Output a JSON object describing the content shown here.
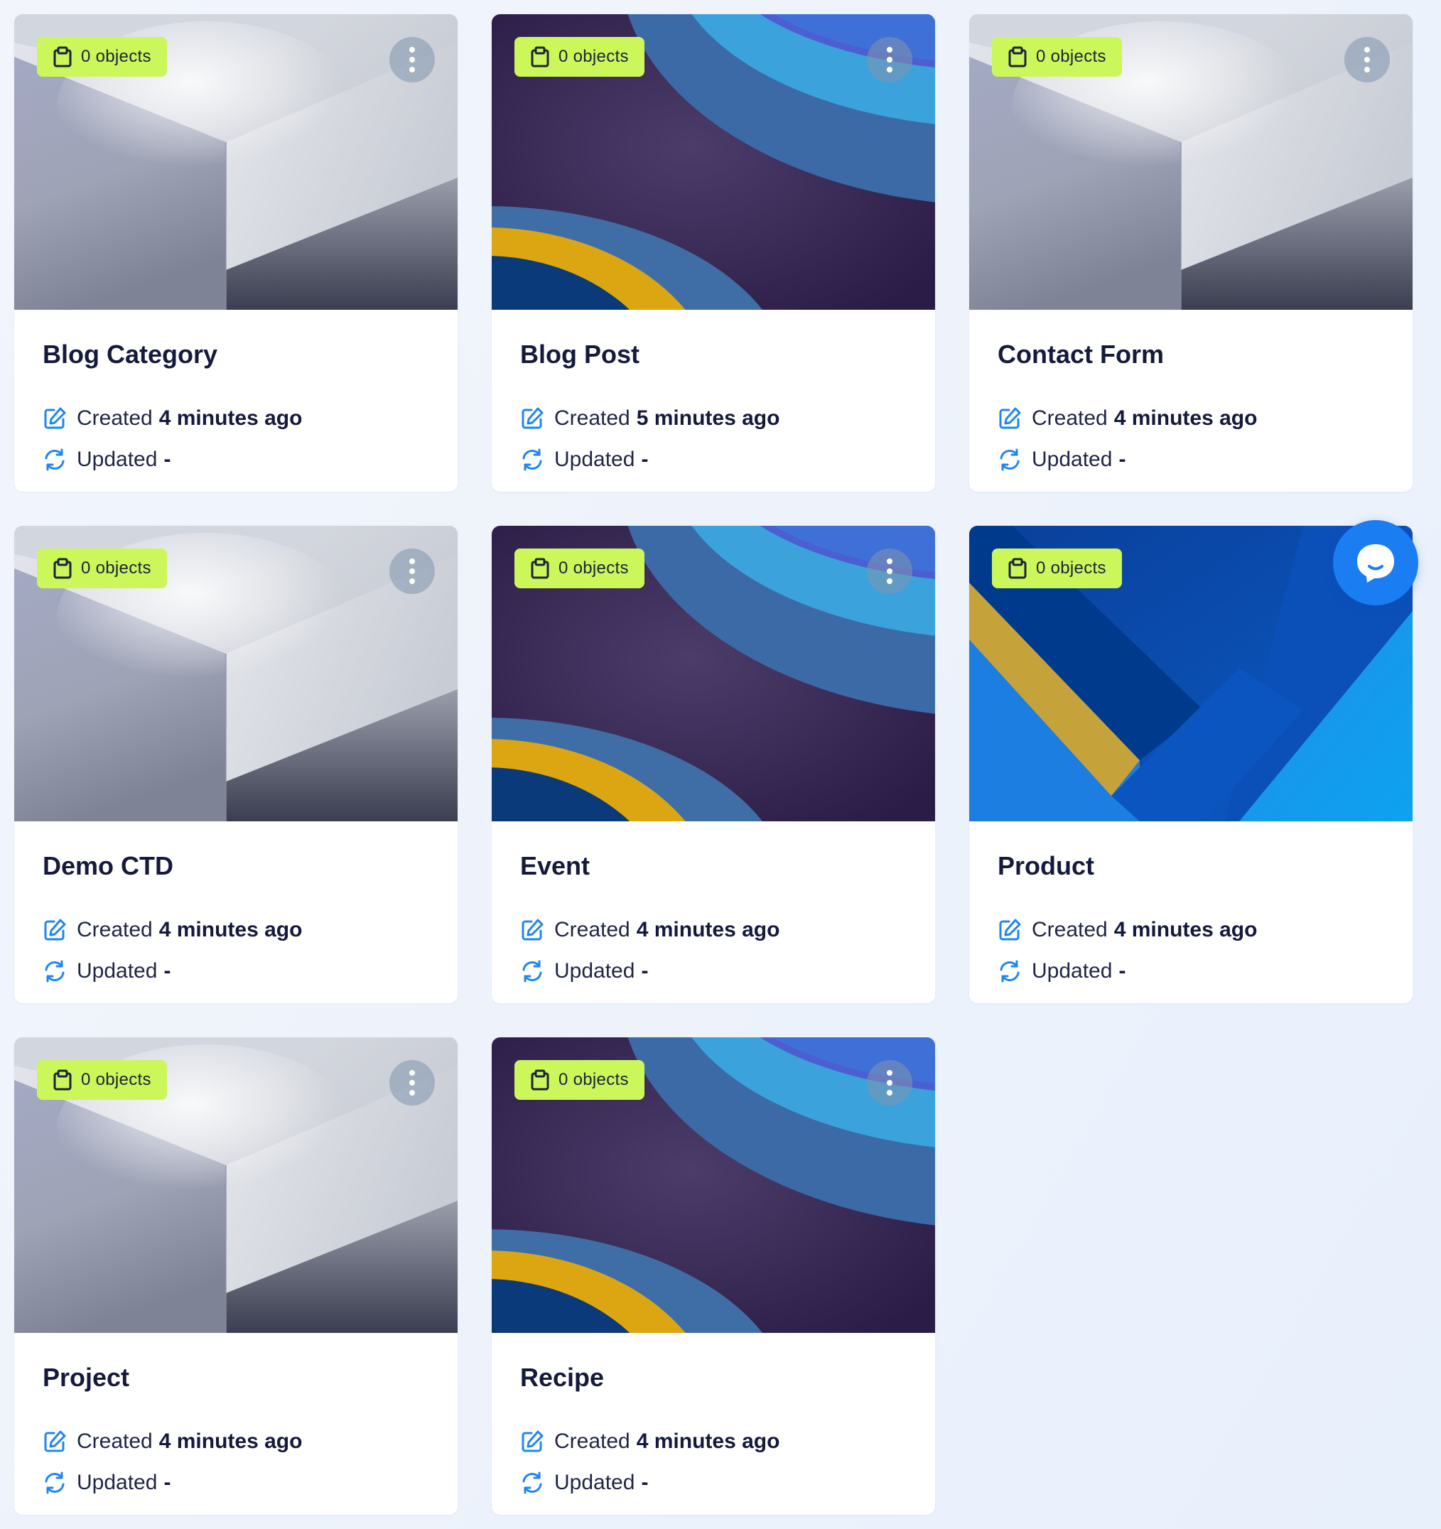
{
  "cards": [
    {
      "title": "Blog Category",
      "objects": "0 objects",
      "created_label": "Created",
      "created_value": "4 minutes ago",
      "updated_label": "Updated",
      "updated_value": "-",
      "image": "grey-geometric"
    },
    {
      "title": "Blog Post",
      "objects": "0 objects",
      "created_label": "Created",
      "created_value": "5 minutes ago",
      "updated_label": "Updated",
      "updated_value": "-",
      "image": "blue-waves"
    },
    {
      "title": "Contact Form",
      "objects": "0 objects",
      "created_label": "Created",
      "created_value": "4 minutes ago",
      "updated_label": "Updated",
      "updated_value": "-",
      "image": "grey-geometric"
    },
    {
      "title": "Demo CTD",
      "objects": "0 objects",
      "created_label": "Created",
      "created_value": "4 minutes ago",
      "updated_label": "Updated",
      "updated_value": "-",
      "image": "grey-geometric"
    },
    {
      "title": "Event",
      "objects": "0 objects",
      "created_label": "Created",
      "created_value": "4 minutes ago",
      "updated_label": "Updated",
      "updated_value": "-",
      "image": "blue-waves"
    },
    {
      "title": "Product",
      "objects": "0 objects",
      "created_label": "Created",
      "created_value": "4 minutes ago",
      "updated_label": "Updated",
      "updated_value": "-",
      "image": "blue-diagonal"
    },
    {
      "title": "Project",
      "objects": "0 objects",
      "created_label": "Created",
      "created_value": "4 minutes ago",
      "updated_label": "Updated",
      "updated_value": "-",
      "image": "grey-geometric"
    },
    {
      "title": "Recipe",
      "objects": "0 objects",
      "created_label": "Created",
      "created_value": "4 minutes ago",
      "updated_label": "Updated",
      "updated_value": "-",
      "image": "blue-waves"
    }
  ],
  "icons": {
    "badge": "clipboard-icon",
    "menu": "more-vertical-icon",
    "created": "edit-icon",
    "updated": "refresh-icon",
    "chat": "chat-bubble-icon"
  },
  "colors": {
    "badge_bg": "#ccf75a",
    "accent_blue": "#1a7ef2",
    "title_text": "#151a3c",
    "page_bg": "#eef3fb"
  }
}
